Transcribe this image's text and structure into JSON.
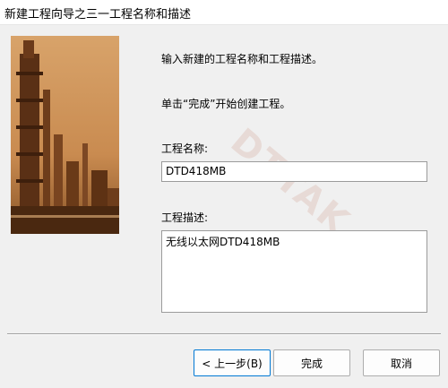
{
  "window": {
    "title": "新建工程向导之三一工程名称和描述"
  },
  "illustration": {
    "watermark": "DTTAK"
  },
  "instructions": {
    "line1": "输入新建的工程名称和工程描述。",
    "line2": "单击“完成”开始创建工程。"
  },
  "project_name": {
    "label": "工程名称:",
    "value": "DTD418MB"
  },
  "project_description": {
    "label": "工程描述:",
    "value": "无线以太网DTD418MB"
  },
  "buttons": {
    "back_label": "< 上一步(B)",
    "finish_label": "完成",
    "cancel_label": "取消"
  },
  "colors": {
    "dialog_background": "#f0f0f0",
    "image_tone": "#c98e52",
    "focus_border": "#0078d4"
  }
}
